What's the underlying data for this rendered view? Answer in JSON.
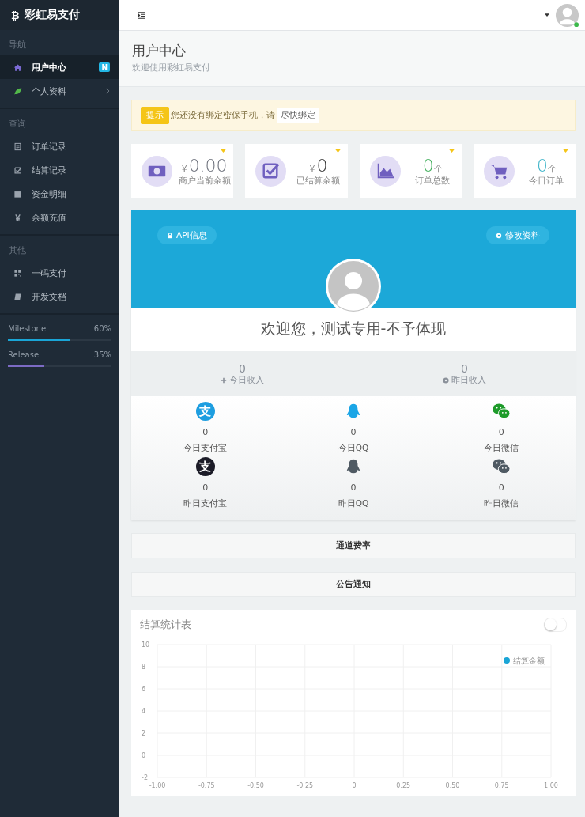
{
  "sidebar": {
    "logo_glyph": "₿",
    "brand": "彩虹易支付",
    "sections": [
      {
        "heading": "导航",
        "items": [
          {
            "label": "用户中心",
            "kind": "home",
            "selected": true,
            "badge": "N",
            "has_submenu": false
          },
          {
            "label": "个人资料",
            "kind": "leaf",
            "selected": false,
            "has_submenu": true
          }
        ]
      },
      {
        "heading": "查询",
        "items": [
          {
            "label": "订单记录",
            "kind": "list",
            "selected": false,
            "has_submenu": false
          },
          {
            "label": "结算记录",
            "kind": "check",
            "selected": false,
            "has_submenu": false
          },
          {
            "label": "资金明细",
            "kind": "calendar",
            "selected": false,
            "has_submenu": false
          },
          {
            "label": "余额充值",
            "kind": "yen",
            "selected": false,
            "has_submenu": false
          }
        ]
      },
      {
        "heading": "其他",
        "items": [
          {
            "label": "一码支付",
            "kind": "qr",
            "selected": false,
            "has_submenu": false
          },
          {
            "label": "开发文档",
            "kind": "book",
            "selected": false,
            "has_submenu": false
          }
        ]
      }
    ],
    "progress": [
      {
        "label": "Milestone",
        "reading": "60%",
        "level": 0.6,
        "color": "#1aa5d6"
      },
      {
        "label": "Release",
        "reading": "35%",
        "level": 0.35,
        "color": "#7c6bc4"
      }
    ]
  },
  "page_header": {
    "title": "用户中心",
    "subtitle": "欢迎使用彩虹易支付"
  },
  "alert": {
    "tag": "提示",
    "message": "您还没有绑定密保手机，请",
    "button": "尽快绑定"
  },
  "stats": [
    {
      "kind": "money",
      "prefix": "¥",
      "value": "0.00",
      "label": "商户当前余额",
      "color": "#6b6f7a"
    },
    {
      "kind": "check",
      "prefix": "¥",
      "value": "0",
      "label": "已结算余额",
      "color": "#333333"
    },
    {
      "kind": "chart",
      "value": "0",
      "unit": "个",
      "label": "订单总数",
      "color": "#3fae5a"
    },
    {
      "kind": "cart",
      "value": "0",
      "unit": "个",
      "label": "今日订单",
      "color": "#3bb3c8"
    }
  ],
  "profile": {
    "buttons": [
      {
        "label": "API信息",
        "kind": "lock"
      },
      {
        "label": "修改资料",
        "kind": "gear"
      }
    ],
    "welcome": "欢迎您，测试专用-不予体现",
    "income": [
      {
        "value": "0",
        "label": "今日收入",
        "kind": "plus"
      },
      {
        "value": "0",
        "label": "昨日收入",
        "kind": "circle"
      }
    ],
    "channels": [
      {
        "kind": "alipay",
        "icon_text": "支",
        "color": "#1e9ee0",
        "value": "0",
        "label": "今日支付宝"
      },
      {
        "kind": "qq",
        "color": "#1aa5e6",
        "value": "0",
        "label": "今日QQ"
      },
      {
        "kind": "wechat",
        "color": "#1e9b2a",
        "value": "0",
        "label": "今日微信"
      },
      {
        "kind": "alipay",
        "icon_text": "支",
        "color": "#1c1c28",
        "value": "0",
        "label": "昨日支付宝"
      },
      {
        "kind": "qq",
        "color": "#4f5a63",
        "value": "0",
        "label": "昨日QQ"
      },
      {
        "kind": "wechat",
        "color": "#4f5a63",
        "value": "0",
        "label": "昨日微信"
      }
    ]
  },
  "panels": [
    "通道费率",
    "公告通知"
  ],
  "chart": {
    "title": "结算统计表",
    "toggle": {
      "on": false
    },
    "chart_data": {
      "type": "line",
      "series": [
        {
          "name": "结算金额",
          "color": "#1aa5d6",
          "values": [
            null,
            null,
            null,
            null,
            null,
            null,
            null,
            null,
            null
          ]
        }
      ],
      "categories": [
        "-1.00",
        "-0.75",
        "-0.50",
        "-0.25",
        "0",
        "0.25",
        "0.50",
        "0.75",
        "1.00"
      ],
      "ylim": [
        -2,
        10
      ],
      "grid": true,
      "yticks": [
        -2,
        0,
        2,
        4,
        6,
        8,
        10
      ]
    }
  }
}
